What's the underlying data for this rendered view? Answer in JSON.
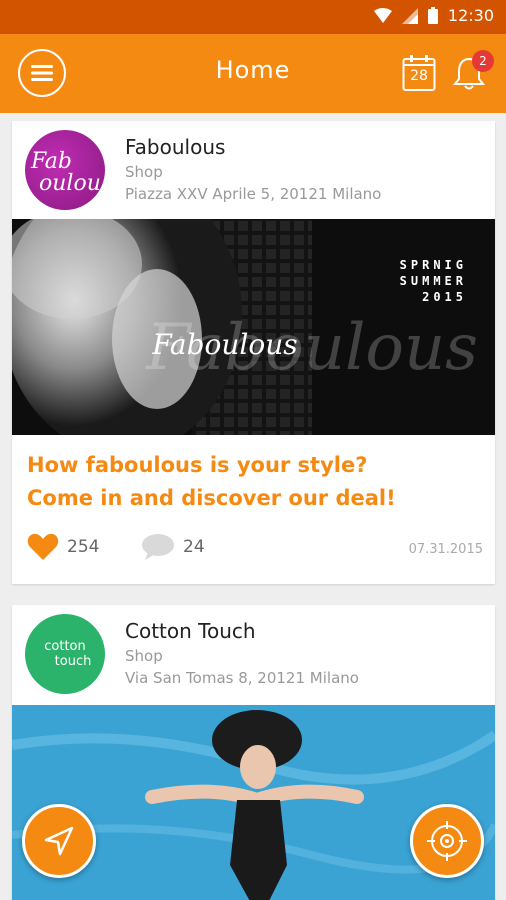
{
  "statusbar": {
    "time": "12:30"
  },
  "appbar": {
    "title": "Home",
    "calendar_day": "28",
    "notification_count": "2"
  },
  "posts": [
    {
      "shop_name": "Faboulous",
      "shop_type": "Shop",
      "address": "Piazza XXV Aprile 5, 20121 Milano",
      "logo_text": "Fab oulou",
      "banner": {
        "brand": "Faboulous",
        "season_line1": "SPRNIG",
        "season_line2": "SUMMER",
        "season_line3": "2015"
      },
      "headline_line1": "How faboulous is your style?",
      "headline_line2": "Come in and discover our deal!",
      "likes": "254",
      "comments": "24",
      "date": "07.31.2015"
    },
    {
      "shop_name": "Cotton Touch",
      "shop_type": "Shop",
      "address": "Via San Tomas 8, 20121 Milano",
      "logo_line1": "cotton",
      "logo_line2": "touch"
    }
  ],
  "colors": {
    "primary": "#f58a13",
    "statusbar": "#d35400",
    "badge": "#e53935",
    "fab_logo_bg": "#9b1e8f",
    "cotton_logo_bg": "#2bb36b"
  }
}
